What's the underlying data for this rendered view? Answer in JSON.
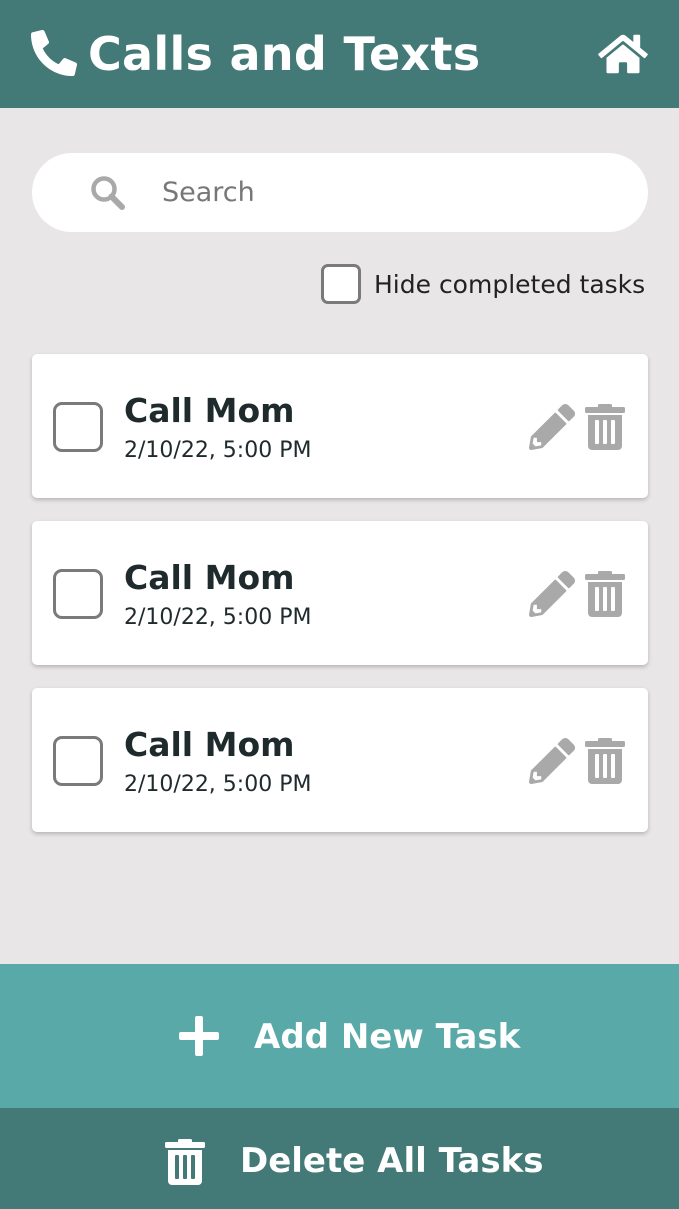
{
  "header": {
    "title": "Calls and Texts",
    "phone_icon": "phone-icon",
    "home_icon": "home-icon"
  },
  "search": {
    "placeholder": "Search",
    "value": "",
    "icon": "search-icon"
  },
  "filter": {
    "hide_completed_label": "Hide completed tasks",
    "hide_completed_checked": false
  },
  "tasks": [
    {
      "title": "Call Mom",
      "datetime": "2/10/22, 5:00 PM",
      "completed": false
    },
    {
      "title": "Call Mom",
      "datetime": "2/10/22, 5:00 PM",
      "completed": false
    },
    {
      "title": "Call Mom",
      "datetime": "2/10/22, 5:00 PM",
      "completed": false
    }
  ],
  "actions": {
    "add_label": "Add New Task",
    "delete_all_label": "Delete All Tasks"
  },
  "colors": {
    "header_bg": "#437976",
    "add_button_bg": "#58a9a8",
    "delete_button_bg": "#437976",
    "page_bg": "#e9e6e7",
    "icon_gray": "#a9a9a9"
  }
}
